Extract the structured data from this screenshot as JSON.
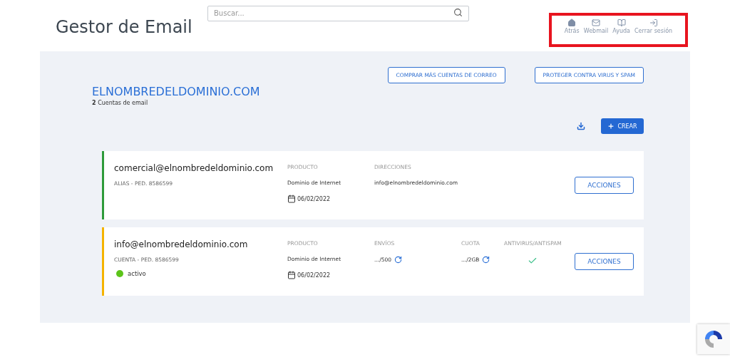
{
  "header": {
    "title": "Gestor de Email",
    "search": {
      "placeholder": "Buscar..."
    },
    "nav": [
      {
        "kind": "home",
        "label": "Atrás"
      },
      {
        "kind": "mail",
        "label": "Webmail"
      },
      {
        "kind": "book",
        "label": "Ayuda"
      },
      {
        "kind": "logout",
        "label": "Cerrar sesión"
      }
    ],
    "highlighted": true
  },
  "domain": {
    "name": "ELNOMBREDELDOMINIO.COM",
    "count": "2",
    "count_label": "Cuentas de email",
    "buttons": [
      "COMPRAR MÁS CUENTAS DE CORREO",
      "PROTEGER CONTRA VIRUS Y SPAM"
    ],
    "create": "CREAR"
  },
  "accounts": [
    {
      "email": "comercial@elnombredeldominio.com",
      "subtitle": "ALIAS - PED. 8586599",
      "color": "#2e9a3a",
      "columns": [
        {
          "kind": "text",
          "heading": "PRODUCTO",
          "value": "Dominio de Internet",
          "date": "06/02/2022"
        },
        {
          "kind": "text",
          "heading": "DIRECCIONES",
          "value": "info@elnombredeldominio.com"
        }
      ],
      "action": "ACCIONES"
    },
    {
      "email": "info@elnombredeldominio.com",
      "subtitle": "CUENTA - PED. 8586599",
      "color": "#f5b300",
      "status": {
        "label": "activo",
        "color": "#5cc41a"
      },
      "columns": [
        {
          "kind": "text",
          "heading": "PRODUCTO",
          "value": "Dominio de Internet",
          "date": "06/02/2022"
        },
        {
          "kind": "refresh",
          "heading": "ENVÍOS",
          "value": ".../500"
        },
        {
          "kind": "refresh",
          "heading": "CUOTA",
          "value": ".../2GB"
        },
        {
          "kind": "check",
          "heading": "ANTIVIRUS/ANTISPAM",
          "checked": true
        }
      ],
      "action": "ACCIONES"
    }
  ]
}
